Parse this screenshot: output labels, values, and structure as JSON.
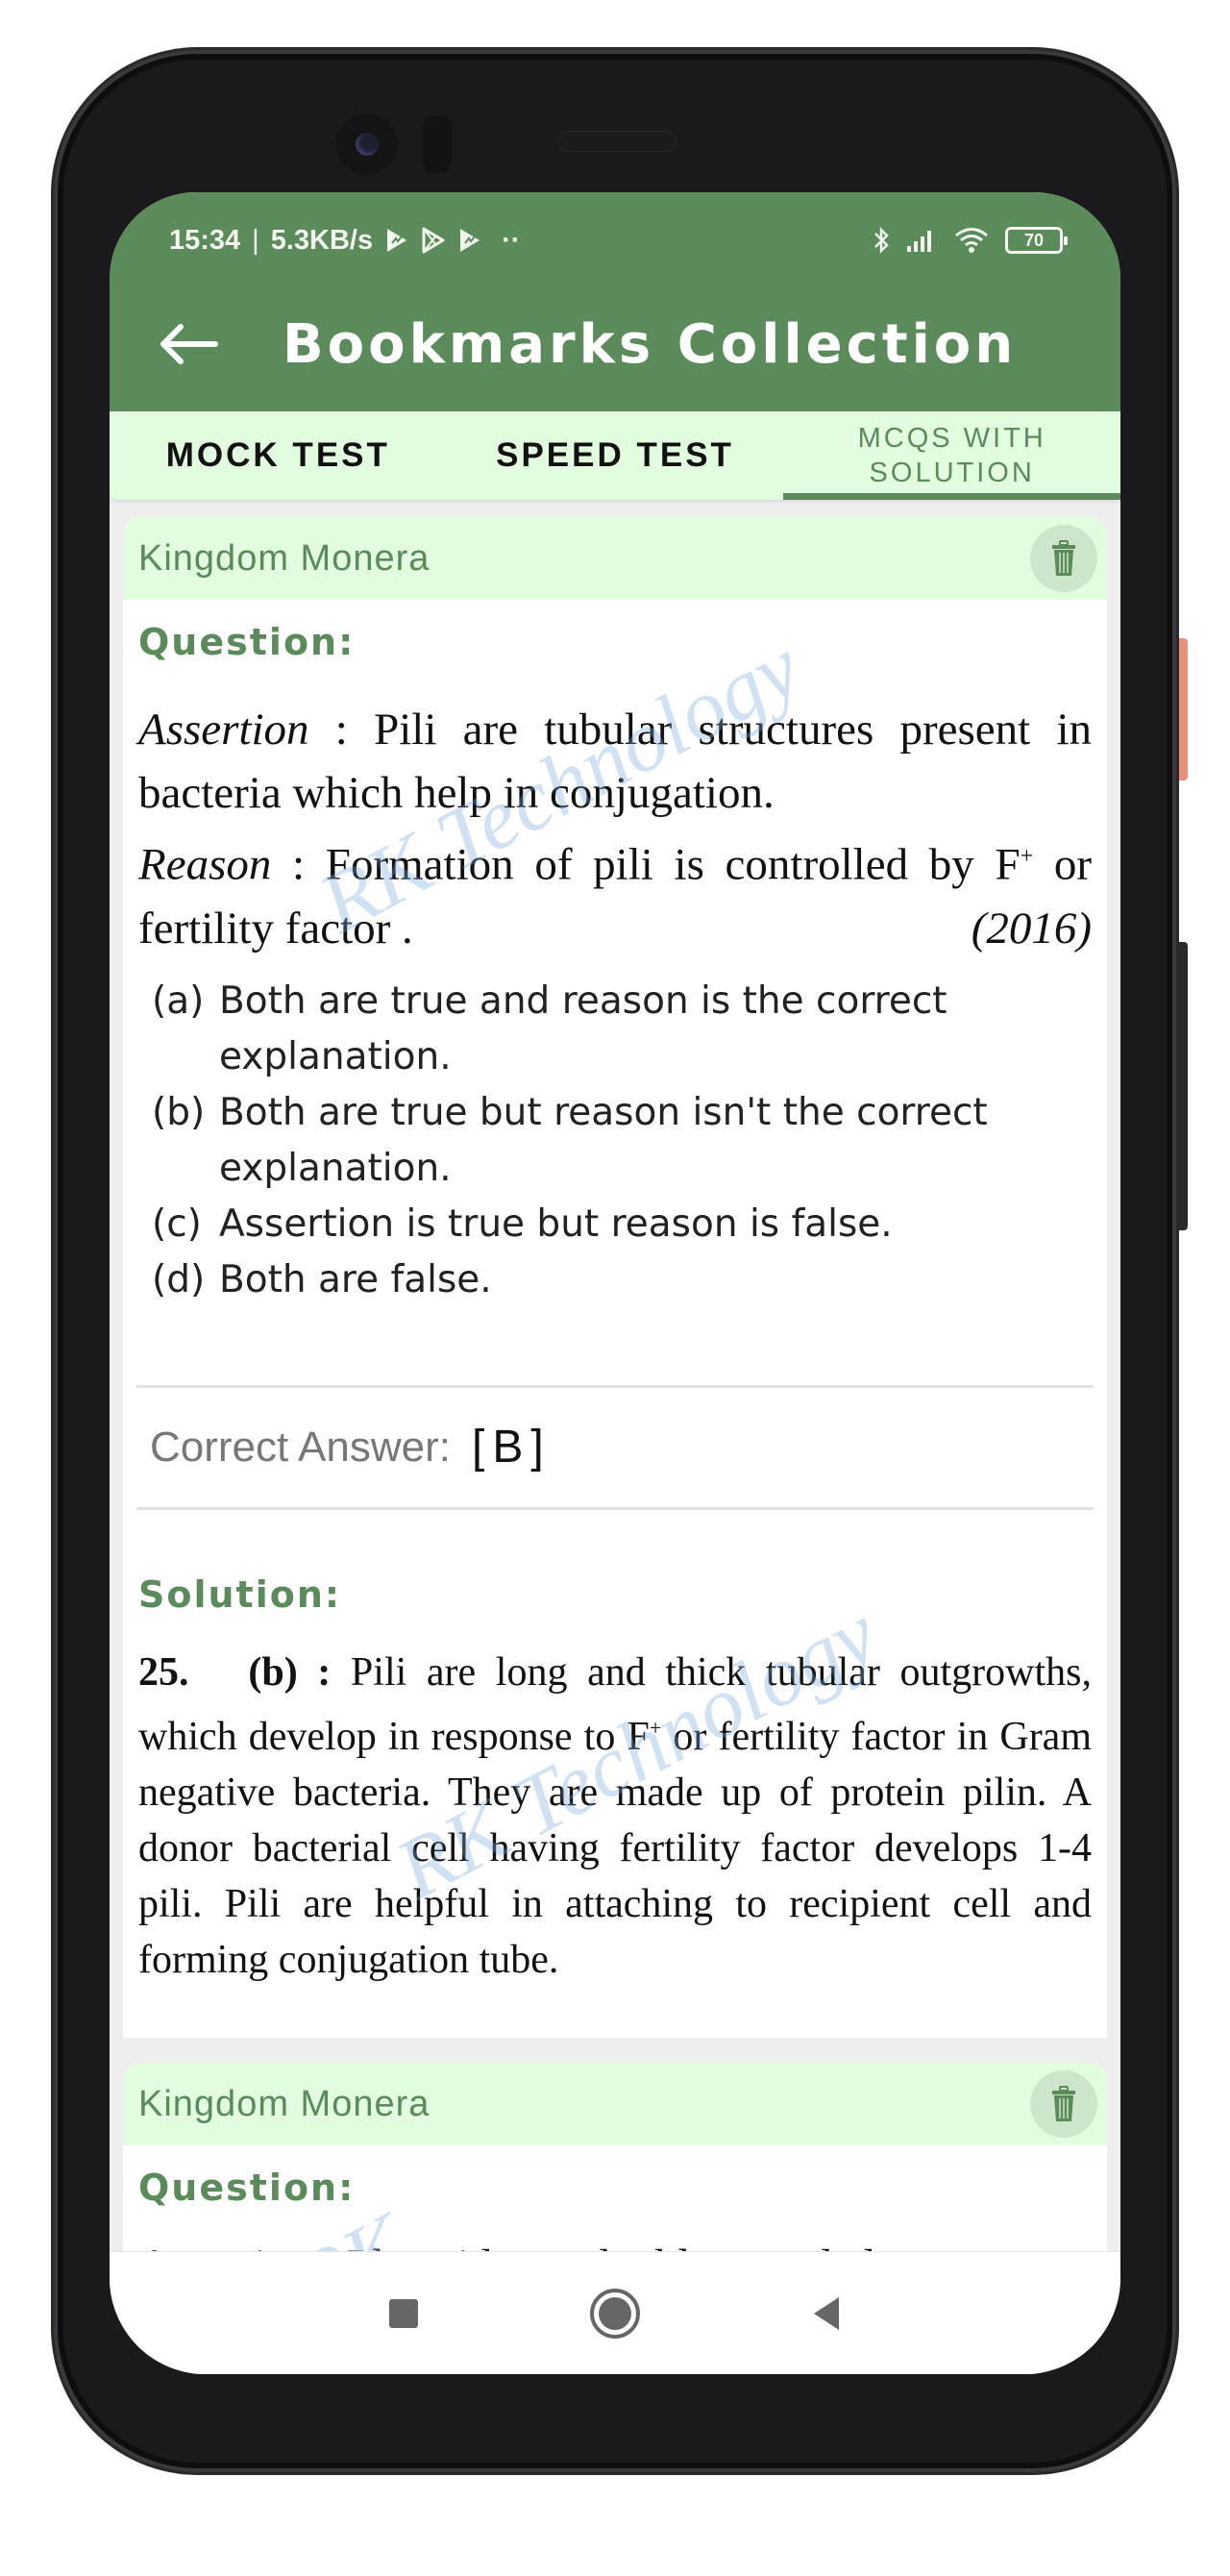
{
  "status_bar": {
    "time": "15:34",
    "separator": "|",
    "net_speed": "5.3KB/s",
    "more_dots": "··",
    "battery": "70"
  },
  "appbar": {
    "title": "Bookmarks Collection"
  },
  "tabs": [
    {
      "label": "MOCK TEST",
      "active": false
    },
    {
      "label": "SPEED TEST",
      "active": false
    },
    {
      "label": "MCQS WITH SOLUTION",
      "line1": "MCQS WITH",
      "line2": "SOLUTION",
      "active": true
    }
  ],
  "cards": [
    {
      "topic": "Kingdom Monera",
      "question_label": "Question:",
      "question": {
        "assertion_label": "Assertion",
        "assertion_text": " : Pili are tubular structures present in bacteria which help in conjugation.",
        "reason_label": "Reason",
        "reason_text": " : Formation of pili is controlled by F",
        "reason_sup": "+",
        "reason_tail": " or fertility factor .",
        "year": "(2016)"
      },
      "options": [
        {
          "key": "(a)",
          "text": "Both are true and reason is the correct explanation."
        },
        {
          "key": "(b)",
          "text": "Both are true but reason isn't the correct explanation."
        },
        {
          "key": "(c)",
          "text": "Assertion is true but reason is false."
        },
        {
          "key": "(d)",
          "text": "Both are false."
        }
      ],
      "correct_answer_label": "Correct Answer:",
      "correct_answer_value": "[B]",
      "solution_label": "Solution:",
      "solution": {
        "number": "25.",
        "option": "(b) :",
        "text_1": " Pili are long and thick tubular outgrowths, which develop in response to F",
        "sup": "+",
        "text_2": " or fertility factor in Gram negative bacteria. They are made up of protein pilin. A donor bacterial cell having fertility factor develops 1-4 pili. Pili are helpful in attaching to recipient cell and forming conjugation tube."
      },
      "watermark": "RK Technology"
    },
    {
      "topic": "Kingdom Monera",
      "question_label": "Question:",
      "question_partial": "Assertion : Plasmids are double stranded",
      "watermark": "RK"
    }
  ],
  "navbar": {
    "recents": "recents-button",
    "home": "home-button",
    "back": "back-button"
  },
  "colors": {
    "primary": "#5b8b5a",
    "tab_bg": "#e2fce0",
    "delete_bg": "#cde6cb",
    "answer_label": "#777777"
  }
}
